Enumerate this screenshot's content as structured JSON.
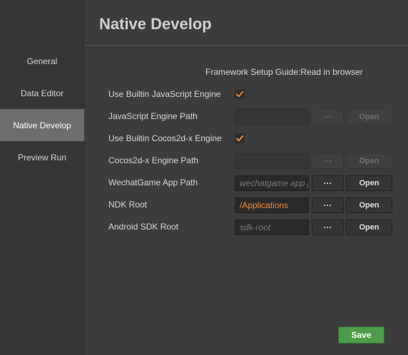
{
  "sidebar": {
    "items": [
      {
        "label": "General"
      },
      {
        "label": "Data Editor"
      },
      {
        "label": "Native Develop",
        "active": true
      },
      {
        "label": "Preview Run"
      }
    ]
  },
  "main": {
    "title": "Native Develop",
    "guide_link": "Framework Setup Guide:Read in browser",
    "use_builtin_js": {
      "label": "Use Builtin JavaScript Engine",
      "checked": true
    },
    "js_engine_path": {
      "label": "JavaScript Engine Path",
      "value": "",
      "dots": "···",
      "open": "Open",
      "disabled": true
    },
    "use_builtin_cocos": {
      "label": "Use Builtin Cocos2d-x Engine",
      "checked": true
    },
    "cocos_engine_path": {
      "label": "Cocos2d-x Engine Path",
      "value": "",
      "dots": "···",
      "open": "Open",
      "disabled": true
    },
    "wechat_path": {
      "label": "WechatGame App Path",
      "placeholder": "wechatgame app path",
      "dots": "···",
      "open": "Open"
    },
    "ndk_root": {
      "label": "NDK Root",
      "value": "/Applications",
      "dots": "···",
      "open": "Open"
    },
    "android_sdk_root": {
      "label": "Android SDK Root",
      "placeholder": "sdk-root",
      "dots": "···",
      "open": "Open"
    }
  },
  "footer": {
    "save_label": "Save"
  },
  "colors": {
    "accent": "#f08b3a",
    "save": "#4c9c48",
    "active_nav": "#6e6e6e"
  }
}
